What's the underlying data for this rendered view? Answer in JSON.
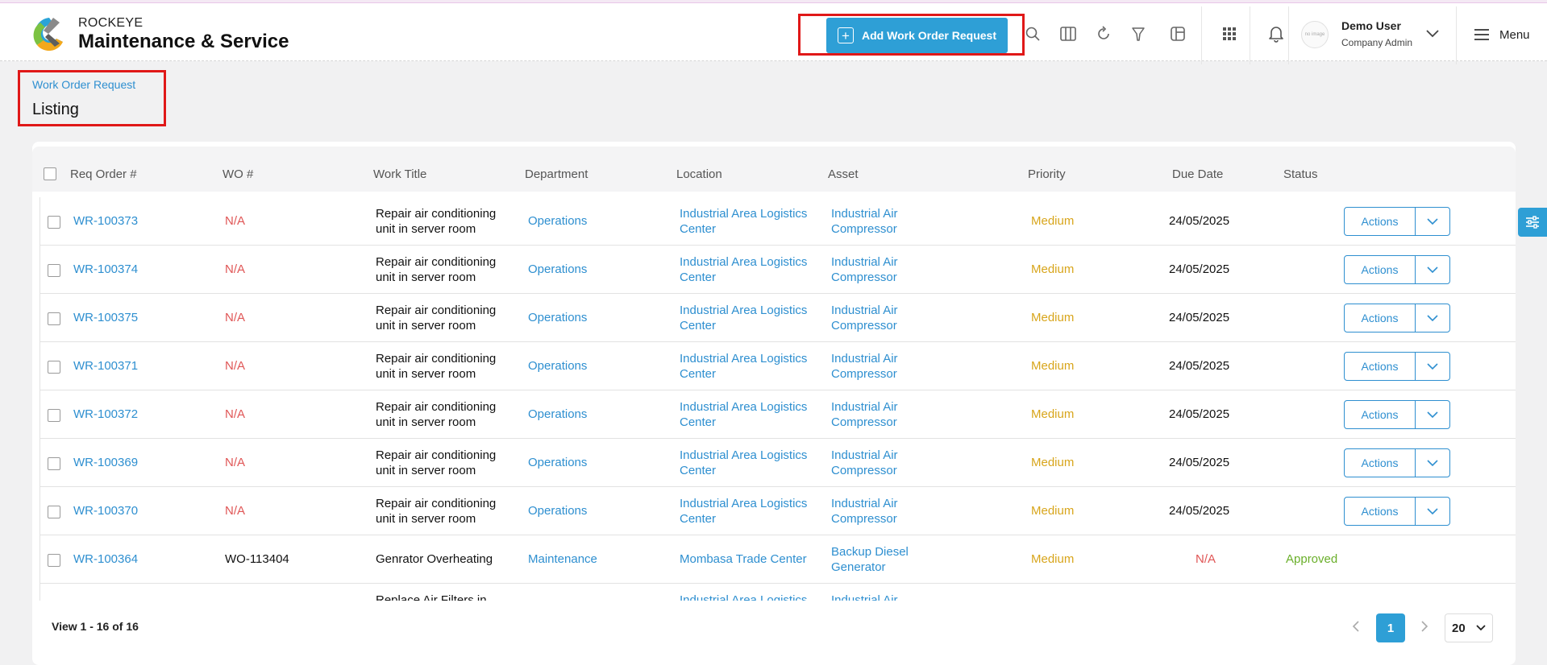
{
  "app": {
    "brand_small": "ROCKEYE",
    "brand_title": "Maintenance & Service"
  },
  "header": {
    "add_button_label": "Add Work Order Request",
    "user_name": "Demo User",
    "user_role": "Company Admin",
    "menu_label": "Menu",
    "icons": [
      "search-icon",
      "columns-icon",
      "refresh-icon",
      "filter-icon",
      "layout-icon",
      "apps-grid-icon",
      "bell-icon",
      "chevron-down-icon",
      "hamburger-icon"
    ]
  },
  "breadcrumb": {
    "link": "Work Order Request",
    "title": "Listing"
  },
  "table": {
    "columns": [
      "Req Order #",
      "WO #",
      "Work Title",
      "Department",
      "Location",
      "Asset",
      "Priority",
      "Due Date",
      "Status"
    ],
    "action_label": "Actions",
    "rows": [
      {
        "req": "WR-100373",
        "wo": "N/A",
        "title1": "Repair air conditioning",
        "title2": "unit in server room",
        "dept": "Operations",
        "loc1": "Industrial Area Logistics",
        "loc2": "Center",
        "asset1": "Industrial Air",
        "asset2": "Compressor",
        "priority": "Medium",
        "due": "24/05/2025",
        "status": ""
      },
      {
        "req": "WR-100374",
        "wo": "N/A",
        "title1": "Repair air conditioning",
        "title2": "unit in server room",
        "dept": "Operations",
        "loc1": "Industrial Area Logistics",
        "loc2": "Center",
        "asset1": "Industrial Air",
        "asset2": "Compressor",
        "priority": "Medium",
        "due": "24/05/2025",
        "status": ""
      },
      {
        "req": "WR-100375",
        "wo": "N/A",
        "title1": "Repair air conditioning",
        "title2": "unit in server room",
        "dept": "Operations",
        "loc1": "Industrial Area Logistics",
        "loc2": "Center",
        "asset1": "Industrial Air",
        "asset2": "Compressor",
        "priority": "Medium",
        "due": "24/05/2025",
        "status": ""
      },
      {
        "req": "WR-100371",
        "wo": "N/A",
        "title1": "Repair air conditioning",
        "title2": "unit in server room",
        "dept": "Operations",
        "loc1": "Industrial Area Logistics",
        "loc2": "Center",
        "asset1": "Industrial Air",
        "asset2": "Compressor",
        "priority": "Medium",
        "due": "24/05/2025",
        "status": ""
      },
      {
        "req": "WR-100372",
        "wo": "N/A",
        "title1": "Repair air conditioning",
        "title2": "unit in server room",
        "dept": "Operations",
        "loc1": "Industrial Area Logistics",
        "loc2": "Center",
        "asset1": "Industrial Air",
        "asset2": "Compressor",
        "priority": "Medium",
        "due": "24/05/2025",
        "status": ""
      },
      {
        "req": "WR-100369",
        "wo": "N/A",
        "title1": "Repair air conditioning",
        "title2": "unit in server room",
        "dept": "Operations",
        "loc1": "Industrial Area Logistics",
        "loc2": "Center",
        "asset1": "Industrial Air",
        "asset2": "Compressor",
        "priority": "Medium",
        "due": "24/05/2025",
        "status": ""
      },
      {
        "req": "WR-100370",
        "wo": "N/A",
        "title1": "Repair air conditioning",
        "title2": "unit in server room",
        "dept": "Operations",
        "loc1": "Industrial Area Logistics",
        "loc2": "Center",
        "asset1": "Industrial Air",
        "asset2": "Compressor",
        "priority": "Medium",
        "due": "24/05/2025",
        "status": ""
      },
      {
        "req": "WR-100364",
        "wo": "WO-113404",
        "title1": "Genrator Overheating",
        "title2": "",
        "dept": "Maintenance",
        "loc1": "Mombasa Trade Center",
        "loc2": "",
        "asset1": "Backup Diesel",
        "asset2": "Generator",
        "priority": "Medium",
        "due": "N/A",
        "status": "Approved"
      },
      {
        "req": "",
        "wo": "",
        "title1": "Replace Air Filters in",
        "title2": "",
        "dept": "",
        "loc1": "Industrial Area Logistics",
        "loc2": "",
        "asset1": "Industrial Air",
        "asset2": "",
        "priority": "",
        "due": "",
        "status": ""
      }
    ]
  },
  "pagination": {
    "view_text": "View 1 - 16 of 16",
    "current_page": "1",
    "page_size": "20"
  },
  "colors": {
    "accent": "#2e9fd6",
    "link": "#2e8fd0",
    "na": "#e05656",
    "medium": "#d8a51b",
    "approved": "#6aaf2a",
    "highlight": "#e01818"
  }
}
